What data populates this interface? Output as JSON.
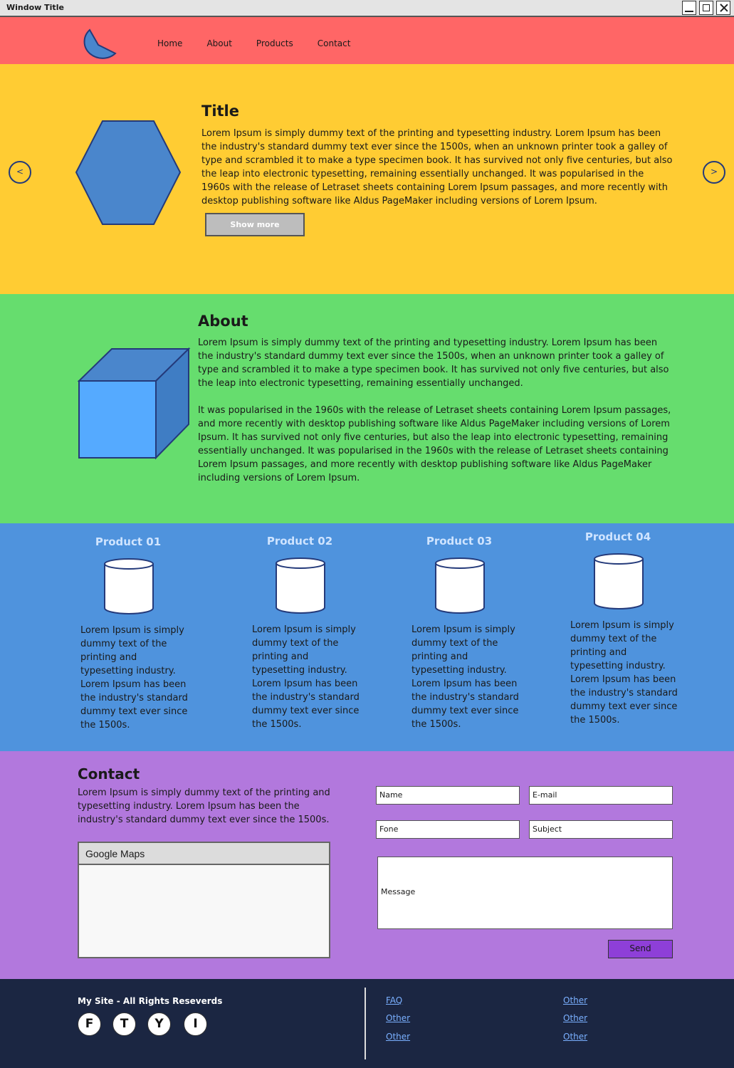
{
  "window": {
    "title": "Window Title"
  },
  "nav": {
    "links": [
      "Home",
      "About",
      "Products",
      "Contact"
    ]
  },
  "hero": {
    "prev_label": "<",
    "next_label": ">",
    "title": "Title",
    "text": "Lorem Ipsum is simply dummy text of the printing and typesetting industry. Lorem Ipsum has been the industry's standard dummy text ever since the 1500s, when an unknown printer took a galley of type and scrambled it to make a type specimen book. It has survived not only five centuries, but also the leap into electronic typesetting, remaining essentially unchanged. It was popularised in the 1960s with the release of Letraset sheets containing Lorem Ipsum passages, and more recently with desktop publishing software like Aldus PageMaker including versions of Lorem Ipsum.",
    "button_label": "Show more"
  },
  "about": {
    "title": "About",
    "paragraph1": "Lorem Ipsum is simply dummy text of the printing and typesetting industry. Lorem Ipsum has been the industry's standard dummy text ever since the 1500s, when an unknown printer took a galley of type and scrambled it to make a type specimen book. It has survived not only five centuries, but also the leap into electronic typesetting, remaining essentially unchanged.",
    "paragraph2": "It was popularised in the 1960s with the release of Letraset sheets containing Lorem Ipsum passages, and more recently with desktop publishing software like Aldus PageMaker including versions of Lorem Ipsum. It has survived not only five centuries, but also the leap into electronic typesetting, remaining essentially unchanged. It was popularised in the 1960s with the release of Letraset sheets containing Lorem Ipsum passages, and more recently with desktop publishing software like Aldus PageMaker including versions of Lorem Ipsum."
  },
  "products": [
    {
      "name": "Product 01",
      "description": "Lorem Ipsum is simply dummy text of the printing and typesetting industry. Lorem Ipsum has been the industry's standard dummy text ever since the 1500s."
    },
    {
      "name": "Product 02",
      "description": "Lorem Ipsum is simply dummy text of the printing and typesetting industry. Lorem Ipsum has been the industry's standard dummy text ever since the 1500s."
    },
    {
      "name": "Product 03",
      "description": "Lorem Ipsum is simply dummy text of the printing and typesetting industry. Lorem Ipsum has been the industry's standard dummy text ever since the 1500s."
    },
    {
      "name": "Product 04",
      "description": "Lorem Ipsum is simply dummy text of the printing and typesetting industry. Lorem Ipsum has been the industry's standard dummy text ever since the 1500s."
    }
  ],
  "contact": {
    "title": "Contact",
    "text": "Lorem Ipsum is simply dummy text of the printing and typesetting industry. Lorem Ipsum has been the industry's standard dummy text ever since the 1500s.",
    "map_title": "Google Maps",
    "fields": {
      "name": "Name",
      "email": "E-mail",
      "phone": "Fone",
      "subject": "Subject",
      "message": "Message"
    },
    "send_label": "Send"
  },
  "footer": {
    "copyright": "My Site - All Rights Reseverds",
    "social": [
      "F",
      "T",
      "Y",
      "I"
    ],
    "links_col1": [
      "FAQ",
      "Other",
      "Other"
    ],
    "links_col2": [
      "Other",
      "Other",
      "Other"
    ]
  },
  "colors": {
    "nav": "#ff6666",
    "hero": "#ffcc33",
    "about": "#66dd6e",
    "products": "#4f93dd",
    "contact": "#b278dd",
    "footer": "#1b2642",
    "shape_fill": "#4a86cc",
    "shape_stroke": "#243a7a"
  },
  "icons": {
    "logo": "pie-logo-icon",
    "hexagon": "hexagon-shape",
    "cube": "cube-shape",
    "product": "cylinder-icon"
  }
}
